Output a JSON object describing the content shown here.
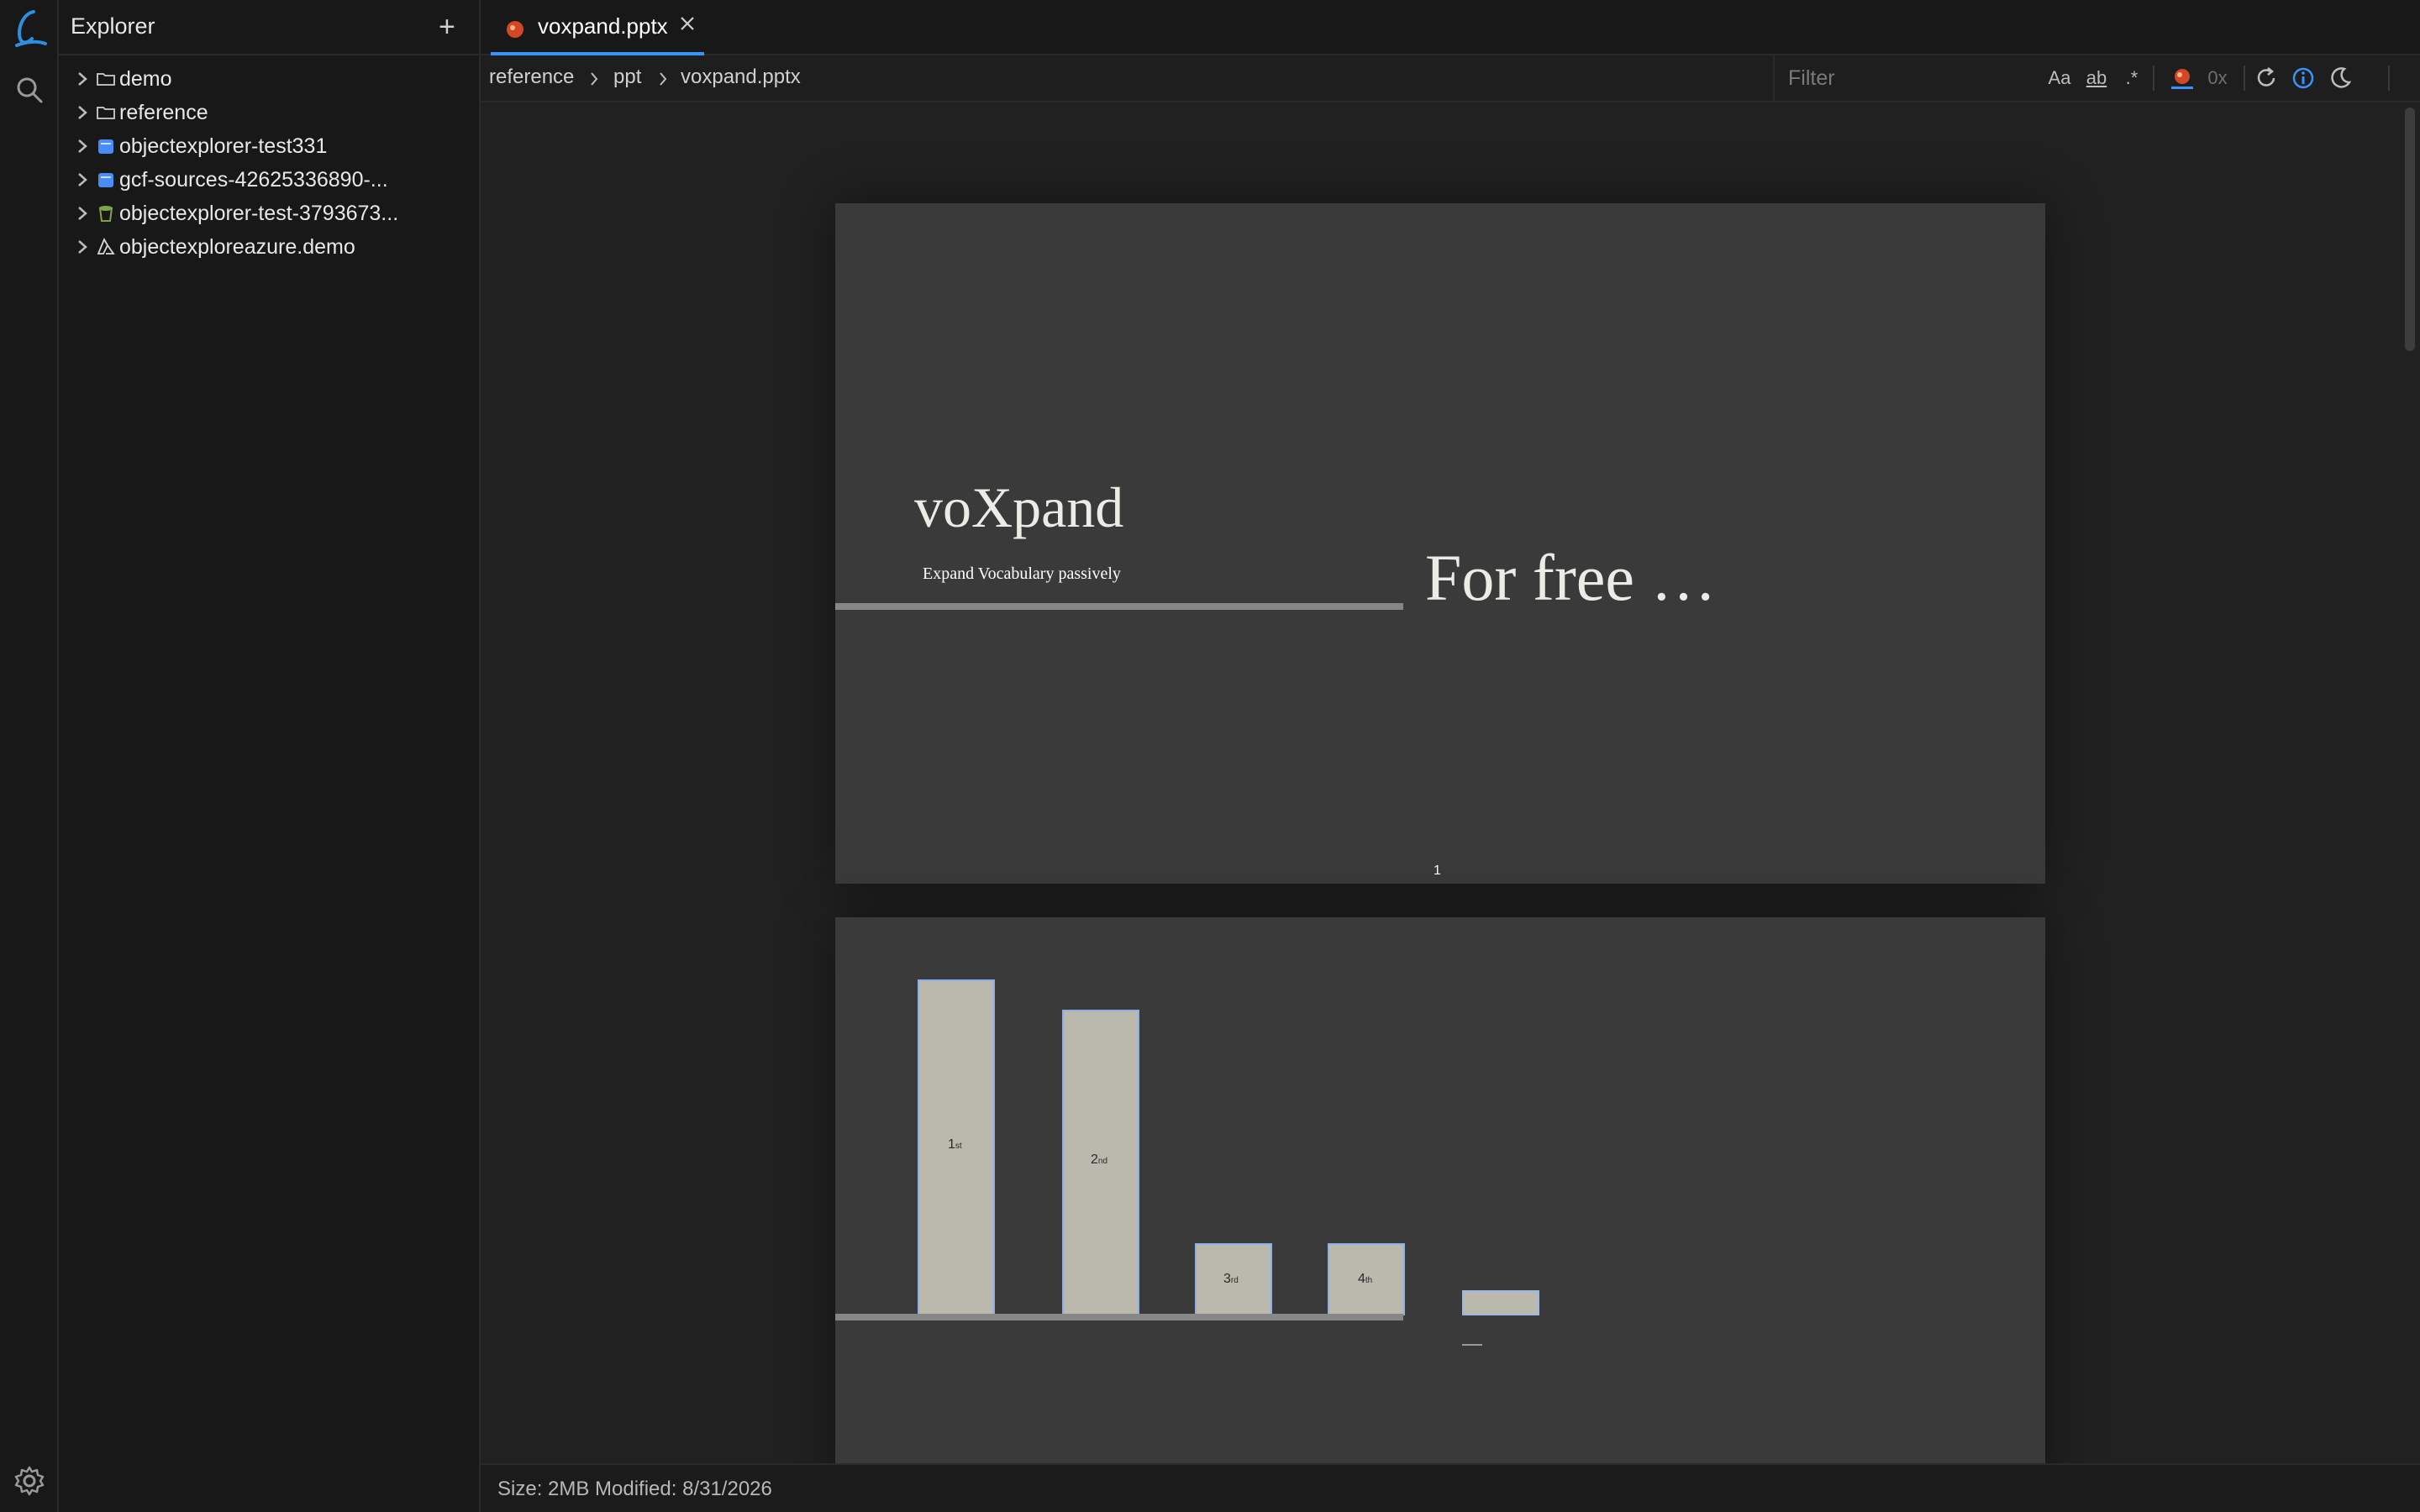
{
  "sidebar": {
    "title": "Explorer",
    "add_label": "+",
    "items": [
      {
        "label": "demo",
        "icon": "folder-icon"
      },
      {
        "label": "reference",
        "icon": "folder-icon"
      },
      {
        "label": "objectexplorer-test331",
        "icon": "bucket-icon",
        "icon_color": "#4a8cf7"
      },
      {
        "label": "gcf-sources-42625336890-...",
        "icon": "bucket-icon",
        "icon_color": "#4a8cf7"
      },
      {
        "label": "objectexplorer-test-3793673...",
        "icon": "storage-icon",
        "icon_color": "#7fa34a"
      },
      {
        "label": "objectexploreazure.demo",
        "icon": "azure-icon"
      }
    ]
  },
  "tab": {
    "label": "voxpand.pptx",
    "accent": "#3794ff"
  },
  "breadcrumb": [
    "reference",
    "ppt",
    "voxpand.pptx"
  ],
  "toolbar": {
    "filter_placeholder": "Filter",
    "match_case": "Aa",
    "whole_word": "ab",
    "regex": ".*",
    "hex_label": "0x"
  },
  "slides": {
    "slide1": {
      "title": "voXpand",
      "subtitle": "Expand Vocabulary passively",
      "big_text": "For free …",
      "page_number": "1"
    },
    "slide2": {
      "bars": [
        {
          "label": "1",
          "suffix": "st"
        },
        {
          "label": "2",
          "suffix": "nd"
        },
        {
          "label": "3",
          "suffix": "rd"
        },
        {
          "label": "4",
          "suffix": "th"
        }
      ]
    }
  },
  "status": {
    "text": "Size: 2MB Modified: 8/31/2026"
  },
  "colors": {
    "accent": "#3794ff",
    "background": "#1e1e1e",
    "slide": "#3a3a3a",
    "bar_fill": "#bbb8ae",
    "bar_border": "#8db0e8"
  }
}
